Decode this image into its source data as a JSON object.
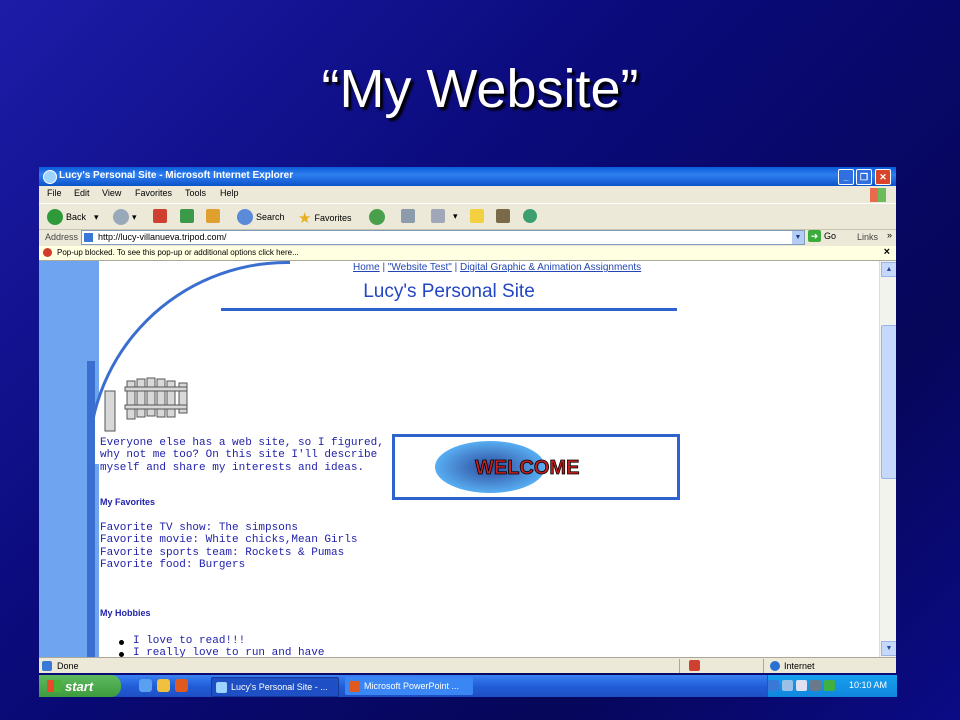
{
  "slide": {
    "title": "“My Website”"
  },
  "window": {
    "title": "Lucy's Personal Site - Microsoft Internet Explorer"
  },
  "menu": [
    "File",
    "Edit",
    "View",
    "Favorites",
    "Tools",
    "Help"
  ],
  "toolbar": {
    "back": "Back",
    "search": "Search",
    "favorites": "Favorites"
  },
  "address": {
    "label": "Address",
    "url": "http://lucy-villanueva.tripod.com/",
    "go": "Go",
    "links": "Links"
  },
  "infobar": {
    "text": "Pop-up blocked. To see this pop-up or additional options click here..."
  },
  "page": {
    "nav": {
      "home": "Home",
      "sep1": " | ",
      "website_test": "\"Website Test\"",
      "sep2": " | ",
      "assignments": "Digital Graphic & Animation Assignments"
    },
    "site_title": "Lucy's Personal Site",
    "intro": "Everyone else has a web site, so I figured, why not me too? On this site I'll describe myself and share my interests and ideas.",
    "favorites_heading": "My Favorites",
    "favorites": [
      "Favorite TV show: The simpsons",
      "Favorite movie: White chicks,Mean Girls",
      "Favorite sports team: Rockets & Pumas",
      "Favorite food: Burgers"
    ],
    "hobbies_heading": "My Hobbies",
    "hobbies": [
      "I love to read!!!",
      "I really love to run and have"
    ],
    "welcome_text": "WELCOME"
  },
  "status": {
    "left": "Done",
    "zone": "Internet"
  },
  "taskbar": {
    "start": "start",
    "tasks": [
      "Lucy's Personal Site - ...",
      "Microsoft PowerPoint ..."
    ],
    "clock": "10:10 AM"
  },
  "colors": {
    "accent": "#2e62cc",
    "page_text": "#2222aa",
    "slide_bg": "#0a0a7a"
  }
}
